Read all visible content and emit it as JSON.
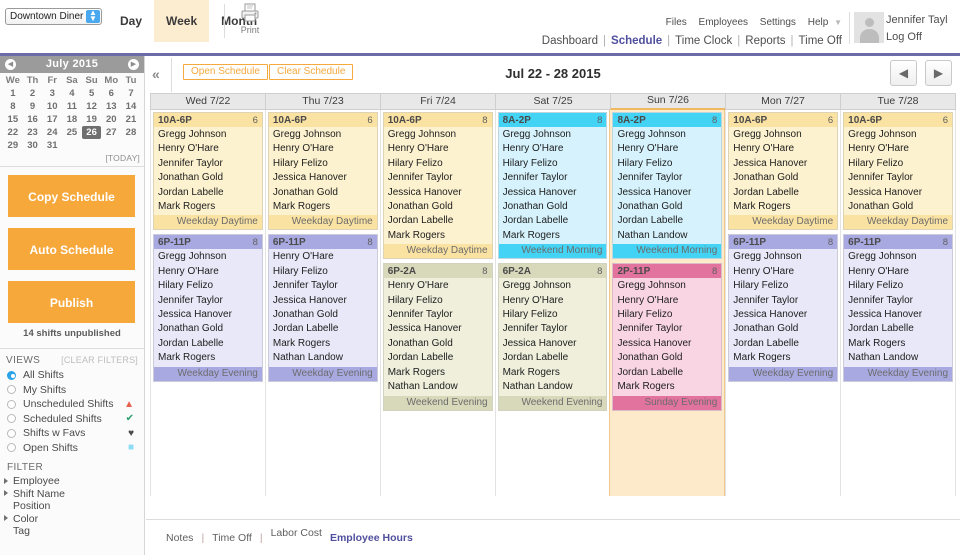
{
  "topbar": {
    "store_select": "Downtown Diner",
    "view_tabs": [
      {
        "label": "Day",
        "active": false
      },
      {
        "label": "Week",
        "active": true
      },
      {
        "label": "Month",
        "active": false
      }
    ],
    "print_label": "Print",
    "secondary_links": [
      "Files",
      "Employees",
      "Settings",
      "Help"
    ],
    "primary_links": [
      {
        "label": "Dashboard",
        "current": false
      },
      {
        "label": "Schedule",
        "current": true
      },
      {
        "label": "Time Clock",
        "current": false
      },
      {
        "label": "Reports",
        "current": false
      },
      {
        "label": "Time Off",
        "current": false
      }
    ],
    "user_name": "Jennifer Tayl",
    "log_off": "Log Off"
  },
  "sidebar": {
    "calendar": {
      "title": "July 2015",
      "prev_label": "◀",
      "next_label": "▶",
      "dow": [
        "We",
        "Th",
        "Fr",
        "Sa",
        "Su",
        "Mo",
        "Tu"
      ],
      "weeks": [
        [
          "1",
          "2",
          "3",
          "4",
          "5",
          "6",
          "7"
        ],
        [
          "8",
          "9",
          "10",
          "11",
          "12",
          "13",
          "14"
        ],
        [
          "15",
          "16",
          "17",
          "18",
          "19",
          "20",
          "21"
        ],
        [
          "22",
          "23",
          "24",
          "25",
          "26",
          "27",
          "28"
        ],
        [
          "29",
          "30",
          "31",
          "",
          "",
          "",
          ""
        ]
      ],
      "selected_day": "26",
      "today_label": "[TODAY]"
    },
    "buttons": [
      {
        "label": "Copy Schedule"
      },
      {
        "label": "Auto Schedule"
      },
      {
        "label": "Publish"
      }
    ],
    "unpublished_note": "14 shifts unpublished",
    "views_title": "VIEWS",
    "clear_filters": "[CLEAR FILTERS]",
    "views": [
      {
        "label": "All Shifts",
        "selected": true,
        "icon": ""
      },
      {
        "label": "My Shifts",
        "selected": false,
        "icon": ""
      },
      {
        "label": "Unscheduled Shifts",
        "selected": false,
        "icon": "warning-triangle-icon",
        "glyph": "▲",
        "color": "#e8604c"
      },
      {
        "label": "Scheduled Shifts",
        "selected": false,
        "icon": "check-circle-icon",
        "glyph": "✔",
        "color": "#2aa06a"
      },
      {
        "label": "Shifts w Favs",
        "selected": false,
        "icon": "heart-icon",
        "glyph": "♥",
        "color": "#4a4a4a"
      },
      {
        "label": "Open Shifts",
        "selected": false,
        "icon": "blue-square-icon",
        "glyph": "■",
        "color": "#8ddcf5"
      }
    ],
    "filter_title": "FILTER",
    "filters": [
      {
        "label": "Employee",
        "expandable": true
      },
      {
        "label": "Shift Name",
        "expandable": true
      },
      {
        "label": "Position",
        "expandable": false
      },
      {
        "label": "Color",
        "expandable": true
      },
      {
        "label": "Tag",
        "expandable": false
      }
    ]
  },
  "schedule": {
    "collapse_label": "«",
    "open_schedule": "Open Schedule",
    "clear_schedule": "Clear Schedule",
    "week_title": "Jul 22 - 28 2015",
    "prev_week": "◀",
    "next_week": "▶",
    "colors": {
      "weekday_daytime": "#fdf2cf",
      "weekday_daytime_band": "#fae2a2",
      "weekday_evening": "#e8e8f8",
      "weekday_evening_band": "#a9a9e2",
      "weekend_evening": "#efefdc",
      "weekend_evening_band": "#d8d8bb",
      "weekend_morning": "#d6f3fd",
      "weekend_morning_band": "#42d3f5",
      "sunday_evening": "#f9d5e3",
      "sunday_evening_band": "#e2739f",
      "selected_column": "#fdeacb",
      "accent_orange": "#f7a83b",
      "accent_purple": "#4f4f9e"
    },
    "days": [
      {
        "header": "Wed 7/22",
        "selected": false,
        "shifts": [
          {
            "time": "10A-6P",
            "count": "6",
            "name": "Weekday Daytime",
            "theme": "weekday_daytime",
            "employees": [
              "Gregg Johnson",
              "Henry O'Hare",
              "Jennifer Taylor",
              "Jonathan Gold",
              "Jordan Labelle",
              "Mark Rogers"
            ]
          },
          {
            "time": "6P-11P",
            "count": "8",
            "name": "Weekday Evening",
            "theme": "weekday_evening",
            "employees": [
              "Gregg Johnson",
              "Henry O'Hare",
              "Hilary Felizo",
              "Jennifer Taylor",
              "Jessica Hanover",
              "Jonathan Gold",
              "Jordan Labelle",
              "Mark Rogers"
            ]
          }
        ]
      },
      {
        "header": "Thu 7/23",
        "selected": false,
        "shifts": [
          {
            "time": "10A-6P",
            "count": "6",
            "name": "Weekday Daytime",
            "theme": "weekday_daytime",
            "employees": [
              "Gregg Johnson",
              "Henry O'Hare",
              "Hilary Felizo",
              "Jessica Hanover",
              "Jonathan Gold",
              "Mark Rogers"
            ]
          },
          {
            "time": "6P-11P",
            "count": "8",
            "name": "Weekday Evening",
            "theme": "weekday_evening",
            "employees": [
              "Henry O'Hare",
              "Hilary Felizo",
              "Jennifer Taylor",
              "Jessica Hanover",
              "Jonathan Gold",
              "Jordan Labelle",
              "Mark Rogers",
              "Nathan Landow"
            ]
          }
        ]
      },
      {
        "header": "Fri 7/24",
        "selected": false,
        "shifts": [
          {
            "time": "10A-6P",
            "count": "8",
            "name": "Weekday Daytime",
            "theme": "weekday_daytime",
            "employees": [
              "Gregg Johnson",
              "Henry O'Hare",
              "Hilary Felizo",
              "Jennifer Taylor",
              "Jessica Hanover",
              "Jonathan Gold",
              "Jordan Labelle",
              "Mark Rogers"
            ]
          },
          {
            "time": "6P-2A",
            "count": "8",
            "name": "Weekend Evening",
            "theme": "weekend_evening",
            "employees": [
              "Henry O'Hare",
              "Hilary Felizo",
              "Jennifer Taylor",
              "Jessica Hanover",
              "Jonathan Gold",
              "Jordan Labelle",
              "Mark Rogers",
              "Nathan Landow"
            ]
          }
        ]
      },
      {
        "header": "Sat 7/25",
        "selected": false,
        "shifts": [
          {
            "time": "8A-2P",
            "count": "8",
            "name": "Weekend Morning",
            "theme": "weekend_morning",
            "employees": [
              "Gregg Johnson",
              "Henry O'Hare",
              "Hilary Felizo",
              "Jennifer Taylor",
              "Jessica Hanover",
              "Jonathan Gold",
              "Jordan Labelle",
              "Mark Rogers"
            ]
          },
          {
            "time": "6P-2A",
            "count": "8",
            "name": "Weekend Evening",
            "theme": "weekend_evening",
            "employees": [
              "Gregg Johnson",
              "Henry O'Hare",
              "Hilary Felizo",
              "Jennifer Taylor",
              "Jessica Hanover",
              "Jordan Labelle",
              "Mark Rogers",
              "Nathan Landow"
            ]
          }
        ]
      },
      {
        "header": "Sun 7/26",
        "selected": true,
        "shifts": [
          {
            "time": "8A-2P",
            "count": "8",
            "name": "Weekend Morning",
            "theme": "weekend_morning",
            "employees": [
              "Gregg Johnson",
              "Henry O'Hare",
              "Hilary Felizo",
              "Jennifer Taylor",
              "Jessica Hanover",
              "Jonathan Gold",
              "Jordan Labelle",
              "Nathan Landow"
            ]
          },
          {
            "time": "2P-11P",
            "count": "8",
            "name": "Sunday Evening",
            "theme": "sunday_evening",
            "employees": [
              "Gregg Johnson",
              "Henry O'Hare",
              "Hilary Felizo",
              "Jennifer Taylor",
              "Jessica Hanover",
              "Jonathan Gold",
              "Jordan Labelle",
              "Mark Rogers"
            ]
          }
        ]
      },
      {
        "header": "Mon 7/27",
        "selected": false,
        "shifts": [
          {
            "time": "10A-6P",
            "count": "6",
            "name": "Weekday Daytime",
            "theme": "weekday_daytime",
            "employees": [
              "Gregg Johnson",
              "Henry O'Hare",
              "Jessica Hanover",
              "Jonathan Gold",
              "Jordan Labelle",
              "Mark Rogers"
            ]
          },
          {
            "time": "6P-11P",
            "count": "8",
            "name": "Weekday Evening",
            "theme": "weekday_evening",
            "employees": [
              "Gregg Johnson",
              "Henry O'Hare",
              "Hilary Felizo",
              "Jennifer Taylor",
              "Jessica Hanover",
              "Jonathan Gold",
              "Jordan Labelle",
              "Mark Rogers"
            ]
          }
        ]
      },
      {
        "header": "Tue 7/28",
        "selected": false,
        "shifts": [
          {
            "time": "10A-6P",
            "count": "6",
            "name": "Weekday Daytime",
            "theme": "weekday_daytime",
            "employees": [
              "Gregg Johnson",
              "Henry O'Hare",
              "Hilary Felizo",
              "Jennifer Taylor",
              "Jessica Hanover",
              "Jonathan Gold"
            ]
          },
          {
            "time": "6P-11P",
            "count": "8",
            "name": "Weekday Evening",
            "theme": "weekday_evening",
            "employees": [
              "Gregg Johnson",
              "Henry O'Hare",
              "Hilary Felizo",
              "Jennifer Taylor",
              "Jessica Hanover",
              "Jordan Labelle",
              "Mark Rogers",
              "Nathan Landow"
            ]
          }
        ]
      }
    ]
  },
  "footer": {
    "links": [
      "Notes",
      "Time Off",
      "Labor Cost"
    ],
    "active_link": "Employee Hours"
  }
}
